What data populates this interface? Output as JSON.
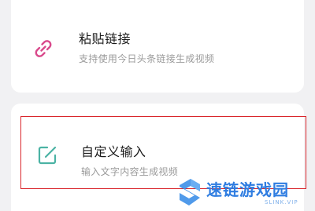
{
  "options": [
    {
      "title": "粘贴链接",
      "subtitle": "支持使用今日头条链接生成视频",
      "icon": "link-icon",
      "icon_color": "#d94a8c"
    },
    {
      "title": "自定义输入",
      "subtitle": "输入文字内容生成视频",
      "icon": "edit-icon",
      "icon_color": "#4bb3a4",
      "highlighted": true,
      "highlight_color": "#d9262c"
    }
  ],
  "watermark": {
    "text": "速链游戏园",
    "sub": "SLINK.VIP",
    "color": "#2f7de1"
  }
}
